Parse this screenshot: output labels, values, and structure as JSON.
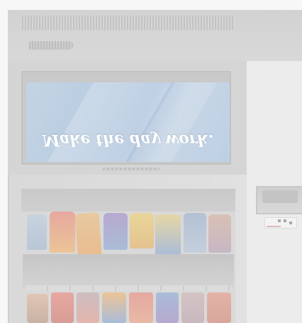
{
  "screen": {
    "slogan": "Make the day work."
  },
  "colors": {
    "cabinet": "#d9d9d9",
    "screen_blue": "#b9cde2",
    "product_red": "#e6a8a0",
    "product_orange": "#ecc497",
    "product_blue": "#a9bcd8",
    "product_purple": "#b7a9cf",
    "product_yellow": "#e9d69a"
  },
  "icons": {
    "vent": "vent-grille-icon",
    "slot": "bill-slot-icon",
    "reader": "card-reader-icon"
  }
}
